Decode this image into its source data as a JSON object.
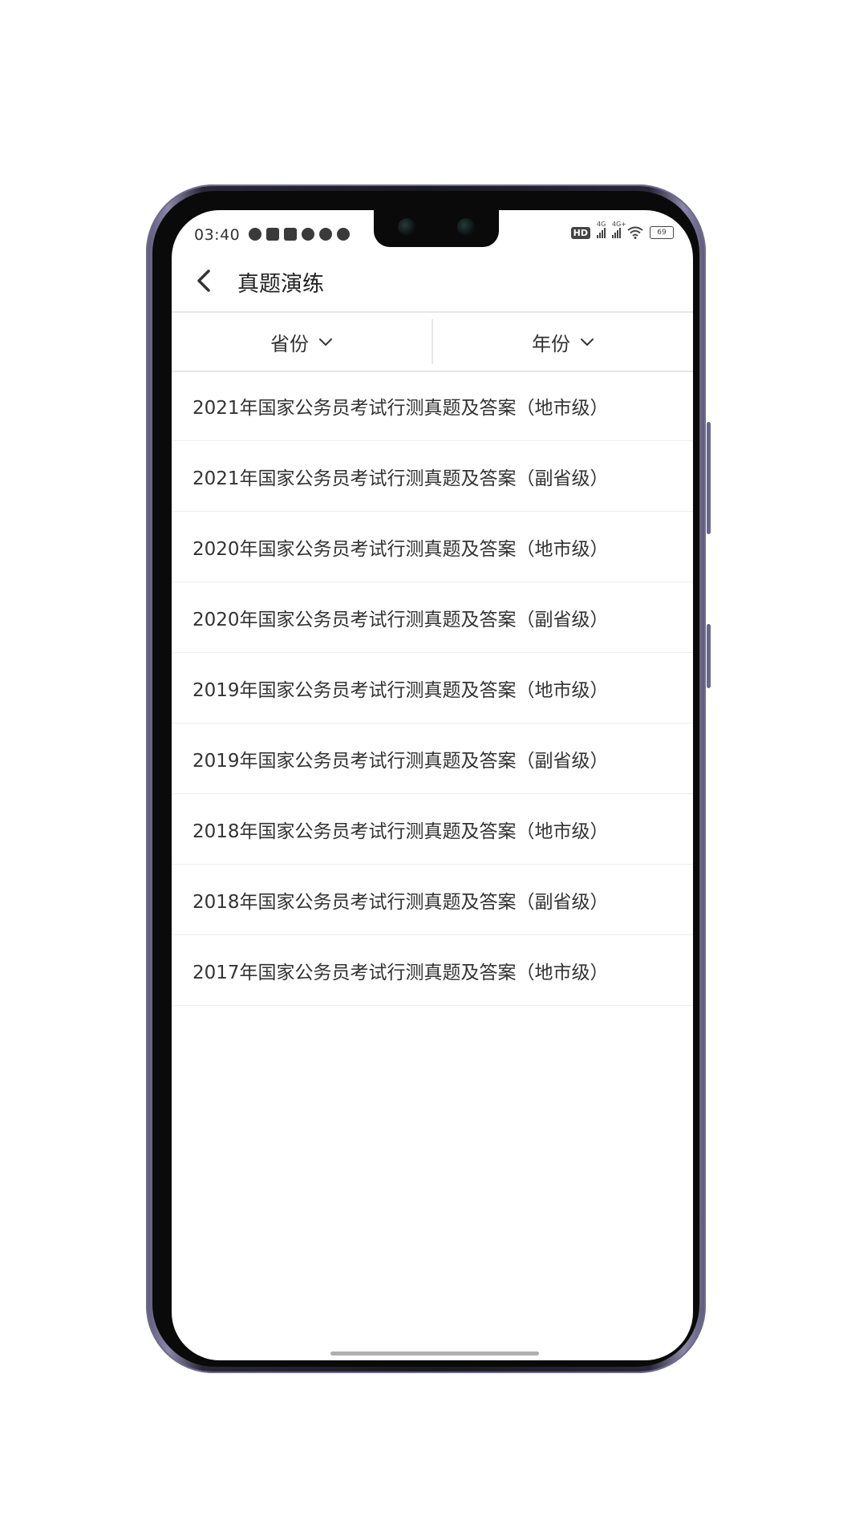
{
  "status_bar": {
    "time": "03:40",
    "hd_label": "HD",
    "signal1_label": "4G",
    "signal2_label": "4G+",
    "battery": "69"
  },
  "header": {
    "title": "真题演练"
  },
  "filters": {
    "province_label": "省份",
    "year_label": "年份"
  },
  "list": {
    "items": [
      {
        "label": "2021年国家公务员考试行测真题及答案（地市级）"
      },
      {
        "label": "2021年国家公务员考试行测真题及答案（副省级）"
      },
      {
        "label": "2020年国家公务员考试行测真题及答案（地市级）"
      },
      {
        "label": "2020年国家公务员考试行测真题及答案（副省级）"
      },
      {
        "label": "2019年国家公务员考试行测真题及答案（地市级）"
      },
      {
        "label": "2019年国家公务员考试行测真题及答案（副省级）"
      },
      {
        "label": "2018年国家公务员考试行测真题及答案（地市级）"
      },
      {
        "label": "2018年国家公务员考试行测真题及答案（副省级）"
      },
      {
        "label": "2017年国家公务员考试行测真题及答案（地市级）"
      }
    ]
  },
  "colors": {
    "text_primary": "#333333",
    "divider": "#e6e6e6",
    "background": "#ffffff"
  }
}
